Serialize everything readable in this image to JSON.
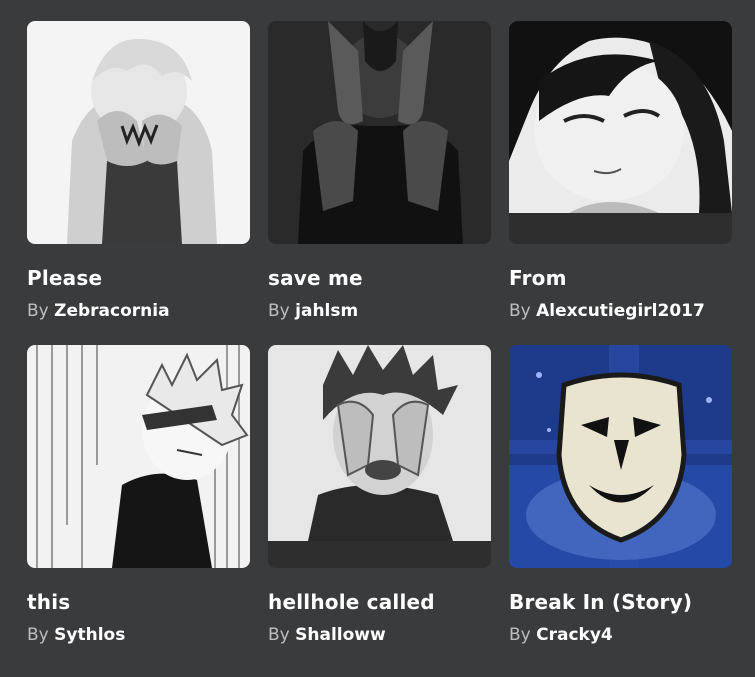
{
  "by_label": "By",
  "items": [
    {
      "title": "Please",
      "creator": "Zebracornia",
      "thumb": "anime-boy-hands-on-face-icon"
    },
    {
      "title": "save me",
      "creator": "jahlsm",
      "thumb": "hands-on-head-dark-icon"
    },
    {
      "title": "From",
      "creator": "Alexcutiegirl2017",
      "thumb": "sad-girl-manga-icon"
    },
    {
      "title": "this",
      "creator": "Sythlos",
      "thumb": "manga-boy-rain-icon"
    },
    {
      "title": "hellhole called",
      "creator": "Shalloww",
      "thumb": "crying-boy-hands-hair-icon"
    },
    {
      "title": "Break In (Story)",
      "creator": "Cracky4",
      "thumb": "white-mask-icon"
    }
  ],
  "colors": {
    "background": "#393b3d",
    "by_text": "#bdbebe",
    "title_text": "#ffffff"
  }
}
